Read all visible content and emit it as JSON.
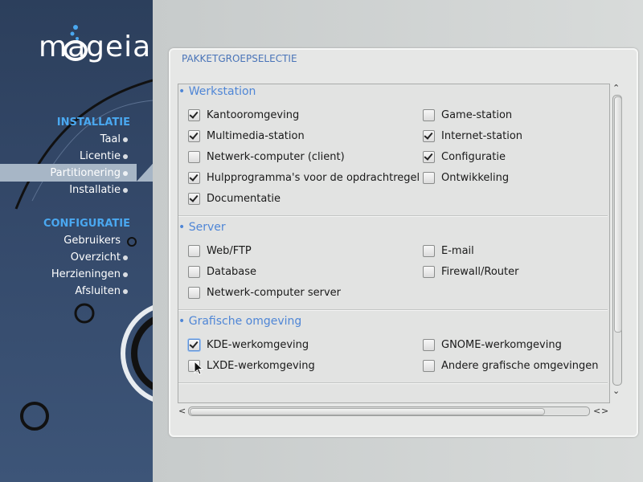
{
  "sidebar": {
    "logo_text": "mageia",
    "section_install": "INSTALLATIE",
    "install_steps": [
      "Taal",
      "Licentie",
      "Partitionering",
      "Installatie"
    ],
    "section_config": "CONFIGURATIE",
    "config_steps": [
      "Gebruikers",
      "Overzicht",
      "Herzieningen",
      "Afsluiten"
    ],
    "active_step": "Partitionering"
  },
  "panel": {
    "title": "PAKKETGROEPSELECTIE",
    "groups": [
      {
        "name": "Werkstation",
        "items": [
          {
            "label": "Kantooromgeving",
            "checked": true
          },
          {
            "label": "Game-station",
            "checked": false
          },
          {
            "label": "Multimedia-station",
            "checked": true
          },
          {
            "label": "Internet-station",
            "checked": true
          },
          {
            "label": "Netwerk-computer (client)",
            "checked": false
          },
          {
            "label": "Configuratie",
            "checked": true
          },
          {
            "label": "Hulpprogramma's voor de opdrachtregel",
            "checked": true
          },
          {
            "label": "Ontwikkeling",
            "checked": false
          },
          {
            "label": "Documentatie",
            "checked": true
          }
        ]
      },
      {
        "name": "Server",
        "items": [
          {
            "label": "Web/FTP",
            "checked": false
          },
          {
            "label": "E-mail",
            "checked": false
          },
          {
            "label": "Database",
            "checked": false
          },
          {
            "label": "Firewall/Router",
            "checked": false
          },
          {
            "label": "Netwerk-computer server",
            "checked": false
          }
        ]
      },
      {
        "name": "Grafische omgeving",
        "items": [
          {
            "label": "KDE-werkomgeving",
            "checked": true
          },
          {
            "label": "GNOME-werkomgeving",
            "checked": false
          },
          {
            "label": "LXDE-werkomgeving",
            "checked": false
          },
          {
            "label": "Andere grafische omgevingen",
            "checked": false
          }
        ]
      }
    ]
  },
  "colors": {
    "accent": "#4aa8f0",
    "group_header": "#4f86d6",
    "sidebar_bg": "#34496a"
  }
}
